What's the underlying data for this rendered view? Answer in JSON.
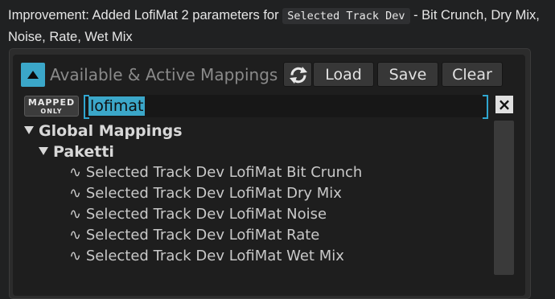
{
  "post": {
    "prefix": "Improvement: Added LofiMat 2 parameters for",
    "code": "Selected Track Dev",
    "suffix": "- Bit Crunch, Dry Mix, Noise, Rate, Wet Mix"
  },
  "toolbar": {
    "title": "Available & Active Mappings",
    "load_label": "Load",
    "save_label": "Save",
    "clear_label": "Clear",
    "accent_color": "#3ba7c9"
  },
  "search": {
    "mapped_only_line1": "MAPPED",
    "mapped_only_line2": "ONLY",
    "value": "lofimat",
    "clear_icon": "×"
  },
  "tree": {
    "global_group": "Global Mappings",
    "sub_group": "Paketti",
    "item_glyph": "∿",
    "items": [
      "Selected Track Dev LofiMat Bit Crunch",
      "Selected Track Dev LofiMat Dry Mix",
      "Selected Track Dev LofiMat Noise",
      "Selected Track Dev LofiMat Rate",
      "Selected Track Dev LofiMat Wet Mix"
    ]
  }
}
